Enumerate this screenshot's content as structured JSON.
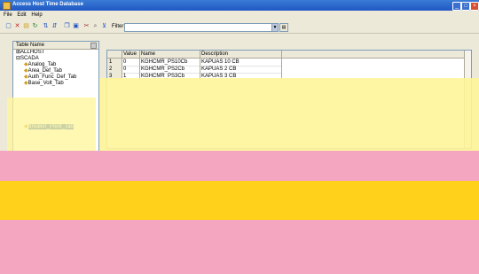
{
  "window": {
    "title": "Access Host Time Database",
    "minimize": "_",
    "maximize": "□",
    "close": "×"
  },
  "menu": [
    {
      "label": "File"
    },
    {
      "label": "Edit"
    },
    {
      "label": "Help"
    }
  ],
  "toolbar": {
    "filter_label": "Filter:",
    "filter_value": ""
  },
  "tree": {
    "header": "Table Name",
    "items": [
      {
        "label": "ALLHOST",
        "prefix": "⊞"
      },
      {
        "label": "SCADA",
        "prefix": "⊟"
      },
      {
        "label": "Analog_Tab",
        "prefix": "◆"
      },
      {
        "label": "Area_Def_Tab",
        "prefix": "◆"
      },
      {
        "label": "Auth_Func_Def_Tab",
        "prefix": "◆"
      },
      {
        "label": "Base_Volt_Tab",
        "prefix": "◆"
      },
      {
        "label": "Breaker_Point_Tab",
        "prefix": "◆"
      }
    ]
  },
  "grid": {
    "columns": [
      "Value",
      "Name",
      "Description"
    ],
    "rows": [
      {
        "num": "1",
        "value": "0",
        "name": "KGHCMR_PS10Cb",
        "description": "KAPUAS 10 CB"
      },
      {
        "num": "2",
        "value": "0",
        "name": "KGHCMR_PS2Cb",
        "description": "KAPUAS 2 CB"
      },
      {
        "num": "3",
        "value": "1",
        "name": "KGHCMR_PS3Cb",
        "description": "KAPUAS 3 CB"
      }
    ]
  },
  "colors": {
    "titlebar": "#1f57c3",
    "selection": "#316ac5",
    "overlay_yellow": "#fff59a",
    "overlay_pink": "#f4a6c0",
    "overlay_orange": "#ffd11a"
  }
}
